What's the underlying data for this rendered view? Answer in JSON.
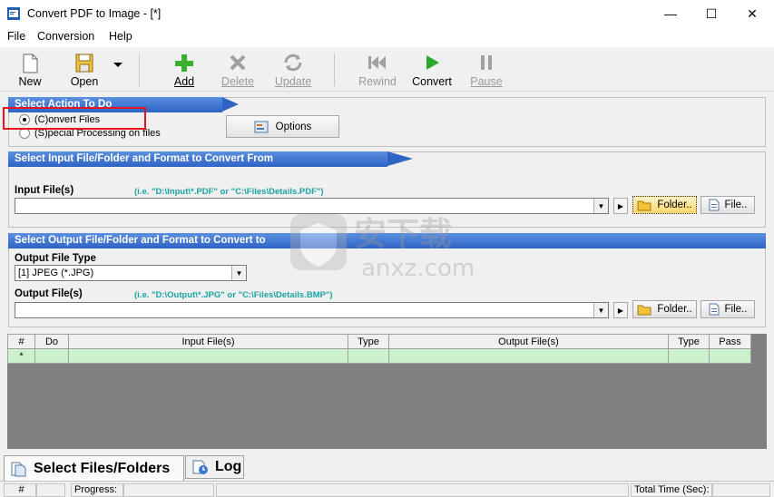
{
  "window": {
    "title": "Convert PDF to Image - [*]",
    "minimize": "—",
    "maximize": "☐",
    "close": "✕"
  },
  "menu": [
    "File",
    "Conversion",
    "Help"
  ],
  "toolbar": {
    "new": "New",
    "open": "Open",
    "add": "Add",
    "delete": "Delete",
    "update": "Update",
    "rewind": "Rewind",
    "convert": "Convert",
    "pause": "Pause"
  },
  "action_section": {
    "header": "Select Action To Do",
    "options": [
      "(C)onvert Files",
      "(S)pecial Processing on files"
    ],
    "selected_index": 0,
    "options_button": "Options"
  },
  "input_section": {
    "header": "Select Input File/Folder and Format to Convert From",
    "label": "Input File(s)",
    "hint": "(i.e. \"D:\\Input\\*.PDF\"  or \"C:\\Files\\Details.PDF\")",
    "value": "",
    "folder_button": "Folder..",
    "file_button": "File.."
  },
  "output_section": {
    "header": "Select Output File/Folder and Format to Convert to",
    "type_label": "Output File Type",
    "type_value": "[1] JPEG (*.JPG)",
    "files_label": "Output File(s)",
    "hint": "(i.e. \"D:\\Output\\*.JPG\"  or \"C:\\Files\\Details.BMP\")",
    "value": "",
    "folder_button": "Folder..",
    "file_button": "File.."
  },
  "grid": {
    "columns": [
      "#",
      "Do",
      "Input File(s)",
      "Type",
      "Output File(s)",
      "Type",
      "Pass"
    ],
    "new_row_marker": "*"
  },
  "tabs": [
    "Select Files/Folders",
    "Log"
  ],
  "status": {
    "hash": "#",
    "progress": "Progress:",
    "total_time": "Total Time (Sec):"
  },
  "watermark": {
    "text": "安下载",
    "domain": "anxz.com"
  },
  "colors": {
    "header_blue": "#2f63c4",
    "hint_teal": "#1ca3a3",
    "grid_row": "#ccf0cc",
    "highlight_red": "#e8141c",
    "grid_bg": "#808080"
  }
}
